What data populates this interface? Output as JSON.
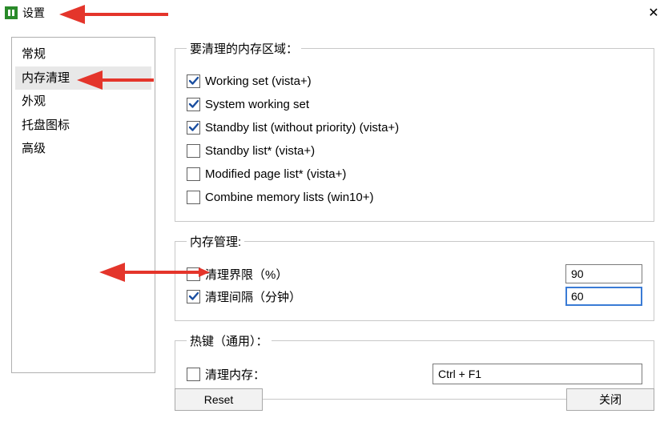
{
  "window": {
    "title": "设置"
  },
  "nav": {
    "items": [
      {
        "label": "常规"
      },
      {
        "label": "内存清理",
        "selected": true
      },
      {
        "label": "外观"
      },
      {
        "label": "托盘图标"
      },
      {
        "label": "高级"
      }
    ]
  },
  "mem_areas": {
    "legend": "要清理的内存区域：",
    "items": [
      {
        "label": "Working set (vista+)",
        "checked": true
      },
      {
        "label": "System working set",
        "checked": true
      },
      {
        "label": "Standby list (without priority) (vista+)",
        "checked": true
      },
      {
        "label": "Standby list* (vista+)",
        "checked": false
      },
      {
        "label": "Modified page list* (vista+)",
        "checked": false
      },
      {
        "label": "Combine memory lists (win10+)",
        "checked": false
      }
    ]
  },
  "mem_mgmt": {
    "legend": "内存管理:",
    "limit_label": "清理界限（%）",
    "limit_checked": false,
    "limit_value": "90",
    "interval_label": "清理间隔（分钟）",
    "interval_checked": true,
    "interval_value": "60"
  },
  "hotkey": {
    "legend": "热键（通用）：",
    "label": "清理内存：",
    "checked": false,
    "value": "Ctrl + F1"
  },
  "buttons": {
    "reset": "Reset",
    "close": "关闭"
  }
}
